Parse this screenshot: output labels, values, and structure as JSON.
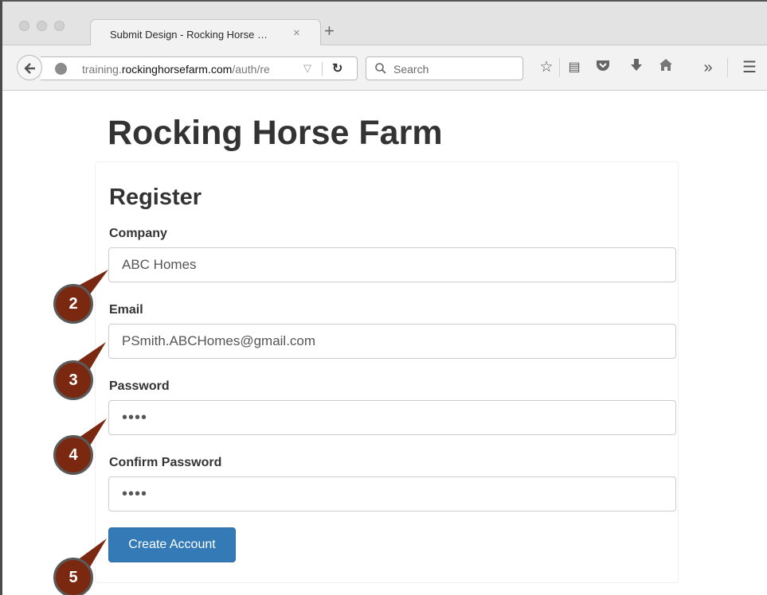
{
  "browser": {
    "tab_title": "Submit Design - Rocking Horse …",
    "tab_close": "×",
    "new_tab": "+",
    "url_prefix": "training.",
    "url_domain": "rockinghorsefarm.com",
    "url_path": "/auth/re",
    "search_placeholder": "Search",
    "toolbar_icons": [
      "bookmark-star-icon",
      "reading-list-icon",
      "pocket-icon",
      "download-icon",
      "home-icon",
      "overflow-icon",
      "menu-icon"
    ]
  },
  "page": {
    "site_title": "Rocking Horse Farm",
    "form_title": "Register",
    "fields": [
      {
        "label": "Company",
        "value": "ABC Homes"
      },
      {
        "label": "Email",
        "value": "PSmith.ABCHomes@gmail.com"
      },
      {
        "label": "Password",
        "value": "••••"
      },
      {
        "label": "Confirm Password",
        "value": "••••"
      }
    ],
    "submit_label": "Create Account"
  },
  "callouts": [
    "2",
    "3",
    "4",
    "5"
  ],
  "colors": {
    "accent": "#337ab7",
    "callout": "#7b2811"
  }
}
